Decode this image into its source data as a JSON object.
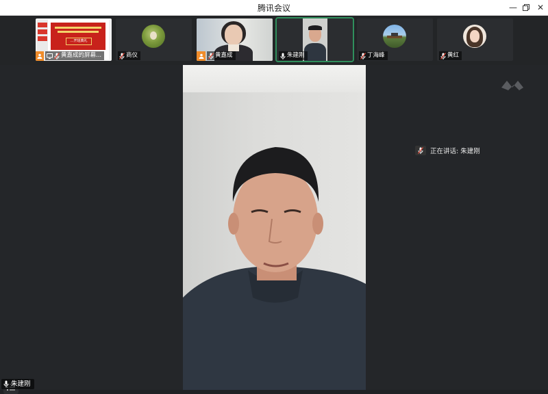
{
  "window": {
    "title": "腾讯会议",
    "minimize_icon": "minimize-icon",
    "restore_icon": "restore-icon",
    "close_icon": "close-icon"
  },
  "participants": [
    {
      "name": "黄嘉成的屏幕...",
      "type": "screen-share",
      "slide_title": "…开班典礼"
    },
    {
      "name": "商仪",
      "type": "avatar"
    },
    {
      "name": "黄嘉成",
      "type": "video"
    },
    {
      "name": "朱建刚",
      "type": "video",
      "active": true
    },
    {
      "name": "丁海峰",
      "type": "avatar"
    },
    {
      "name": "黄红",
      "type": "avatar"
    }
  ],
  "speaking": {
    "label": "正在讲话: 朱建刚"
  },
  "main_video": {
    "participant_name": "朱建刚"
  },
  "colors": {
    "accent_orange": "#f08c2a",
    "active_green": "#2f8f5c",
    "background": "#1f2124"
  }
}
